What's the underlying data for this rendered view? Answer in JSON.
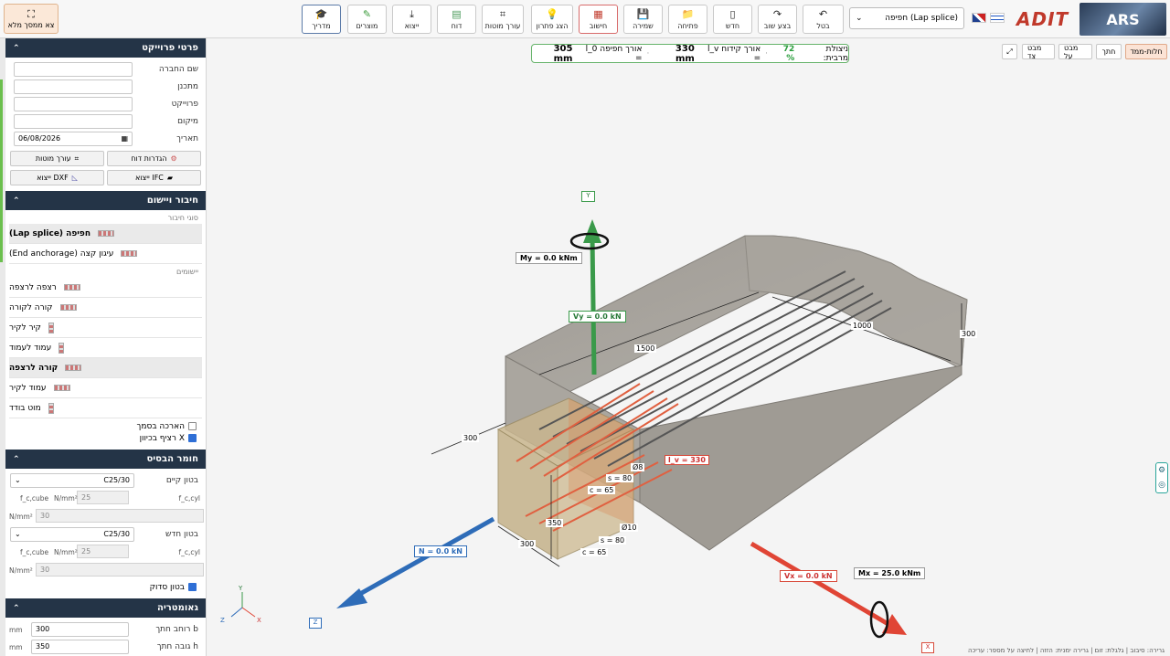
{
  "toolbar": {
    "fullscreen": "צא ממסך מלא",
    "buttons": [
      {
        "key": "guide",
        "label": "מדריך"
      },
      {
        "key": "products",
        "label": "מוצרים"
      },
      {
        "key": "export",
        "label": "ייצוא"
      },
      {
        "key": "report",
        "label": "דוח"
      },
      {
        "key": "rebar_editor",
        "label": "עורך מוטות"
      },
      {
        "key": "show_solution",
        "label": "הצג פתרון"
      },
      {
        "key": "calculate",
        "label": "חישוב"
      },
      {
        "key": "save",
        "label": "שמירה"
      },
      {
        "key": "open",
        "label": "פתיחה"
      },
      {
        "key": "new",
        "label": "חדש"
      },
      {
        "key": "redo",
        "label": "בצע שוב"
      },
      {
        "key": "undo",
        "label": "בטל"
      }
    ],
    "connection_select": "חפיפה (Lap splice)",
    "logo_brand": "ADIT",
    "logo_ars": "ARS"
  },
  "project": {
    "title": "פרטי פרוייקט",
    "fields": [
      {
        "label": "שם החברה",
        "value": ""
      },
      {
        "label": "מתכנן",
        "value": ""
      },
      {
        "label": "פרוייקט",
        "value": ""
      },
      {
        "label": "מיקום",
        "value": ""
      },
      {
        "label": "תאריך",
        "value": "06/08/2026"
      }
    ],
    "btn_report_settings": "הגדרות דוח",
    "btn_rebar_editor": "עורך מוטות",
    "btn_export_ifc": "ייצוא IFC",
    "btn_export_dxf": "ייצוא DXF"
  },
  "connection": {
    "title": "חיבור ויישום",
    "types_label": "סוגי חיבור",
    "types": [
      {
        "label": "חפיפה (Lap splice)",
        "selected": true
      },
      {
        "label": "עיגון קצה (End anchorage)",
        "selected": false
      }
    ],
    "apps_label": "יישומים",
    "applications": [
      {
        "label": "רצפה לרצפה",
        "selected": false,
        "icon": "h"
      },
      {
        "label": "קורה לקורה",
        "selected": false,
        "icon": "h"
      },
      {
        "label": "קיר לקיר",
        "selected": false,
        "icon": "v"
      },
      {
        "label": "עמוד לעמוד",
        "selected": false,
        "icon": "v"
      },
      {
        "label": "קורה לרצפה",
        "selected": true,
        "icon": "h"
      },
      {
        "label": "עמוד לקיר",
        "selected": false,
        "icon": "v"
      },
      {
        "label": "מוט בודד",
        "selected": false,
        "icon": "v"
      }
    ],
    "chk_screen_extension": "הארכה בסמך",
    "chk_screen_extension_on": false,
    "chk_x_direction": "רציף בכיוון X",
    "chk_x_direction_on": true
  },
  "material": {
    "title": "חומר הבסיס",
    "existing_label": "בטון קיים",
    "existing_value": "C25/30",
    "fc_cube_label": "f_c,cube",
    "unit": "N/mm²",
    "fc_cube_value": "25",
    "fc_cyl_label": "f_c,cyl",
    "fc_cyl_value": "30",
    "new_label": "בטון חדש",
    "new_value": "C25/30",
    "new_fc_cube_value": "25",
    "new_fc_cyl_value": "30",
    "cracked_label": "בטון סדוק",
    "cracked_on": true
  },
  "geometry": {
    "title": "גאומטריה",
    "width_label": "רוחב חתך b",
    "width_value": "300",
    "height_label": "גובה חתך h",
    "height_value": "350",
    "unit": "mm"
  },
  "status": {
    "utilization_label": "ניצולת מרבית:",
    "utilization_value": "72 %",
    "lv_label": "אורך קידוח l_v =",
    "lv_value": "330 mm",
    "l0_label": "אורך חפיפה l_0 =",
    "l0_value": "305 mm"
  },
  "view_buttons": {
    "default_view": "חלות-ממד",
    "section": "חתך",
    "top_view": "מבט על",
    "side_view": "מבט צד"
  },
  "scene": {
    "axis_y": "Y",
    "axis_x": "X",
    "axis_z": "Z",
    "my": "My = 0.0 kNm",
    "vy": "Vy = 0.0 kN",
    "n": "N = 0.0 kN",
    "vx": "Vx = 0.0 kN",
    "mx": "Mx = 25.0 kNm",
    "dim_1500": "1500",
    "dim_1000": "1000",
    "dim_300_right": "300",
    "dim_300_left": "300",
    "dim_300_bottom": "300",
    "dim_350": "350",
    "lv": "l_v = 330",
    "d8": "Ø8",
    "s80a": "s = 80",
    "c65a": "c = 65",
    "d10": "Ø10",
    "s80b": "s = 80",
    "c65b": "c = 65"
  },
  "footer": "גרירה: סיבוב | גלגלת: זום | גרירה ימנית: הזזה | לחיצה על מספר: עריכה"
}
